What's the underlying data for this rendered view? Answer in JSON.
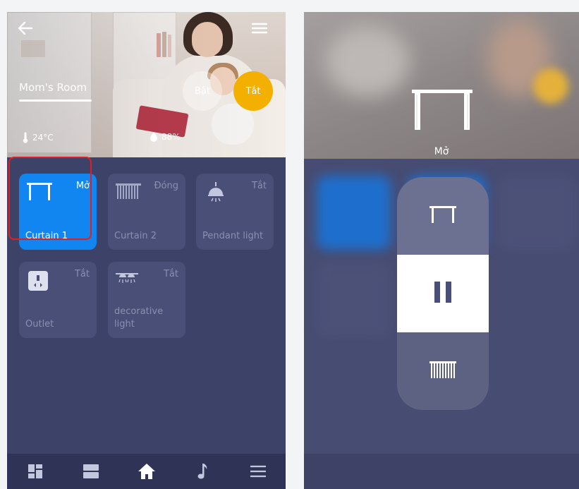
{
  "left_screen": {
    "room_name": "Mom's Room",
    "power_on_label": "Bật",
    "power_off_label": "Tắt",
    "temperature": "24°C",
    "humidity": "88%",
    "devices": [
      {
        "name": "Curtain 1",
        "status": "Mở",
        "icon": "curtain-open-icon",
        "active": true
      },
      {
        "name": "Curtain 2",
        "status": "Đóng",
        "icon": "curtain-closed-icon",
        "active": false
      },
      {
        "name": "Pendant light",
        "status": "Tắt",
        "icon": "pendant-light-icon",
        "active": false
      },
      {
        "name": "Outlet",
        "status": "Tắt",
        "icon": "outlet-icon",
        "active": false
      },
      {
        "name": "decorative light",
        "status": "Tắt",
        "icon": "decorative-light-icon",
        "active": false
      }
    ],
    "bottom_nav": [
      "dashboard-icon",
      "rooms-icon",
      "home-icon",
      "music-icon",
      "menu-icon"
    ]
  },
  "right_screen": {
    "curtain_status": "Mở",
    "controls": [
      "curtain-open-icon",
      "pause-icon",
      "curtain-closed-icon"
    ]
  },
  "colors": {
    "background": "#3c4268",
    "tile": "#4a4f77",
    "tile_active": "#1186f0",
    "accent_yellow": "#f4b000",
    "highlight": "#e02020"
  }
}
